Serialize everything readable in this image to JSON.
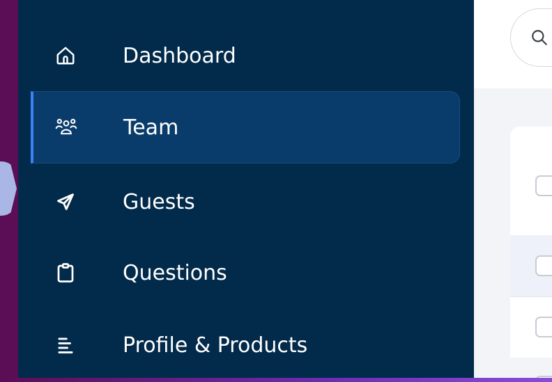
{
  "sidebar": {
    "items": [
      {
        "label": "Dashboard",
        "icon": "home-icon",
        "active": false
      },
      {
        "label": "Team",
        "icon": "team-icon",
        "active": true
      },
      {
        "label": "Guests",
        "icon": "paper-plane-icon",
        "active": false
      },
      {
        "label": "Questions",
        "icon": "clipboard-icon",
        "active": false
      },
      {
        "label": "Profile & Products",
        "icon": "text-align-icon",
        "active": false
      }
    ]
  },
  "colors": {
    "sidebar_bg": "#022a4a",
    "active_item_bg": "#0a3c6b",
    "active_accent": "#3b82f6",
    "content_bg": "#f2f4f8",
    "frame_bg": "#5b0e55"
  },
  "search": {
    "icon": "search-icon"
  }
}
